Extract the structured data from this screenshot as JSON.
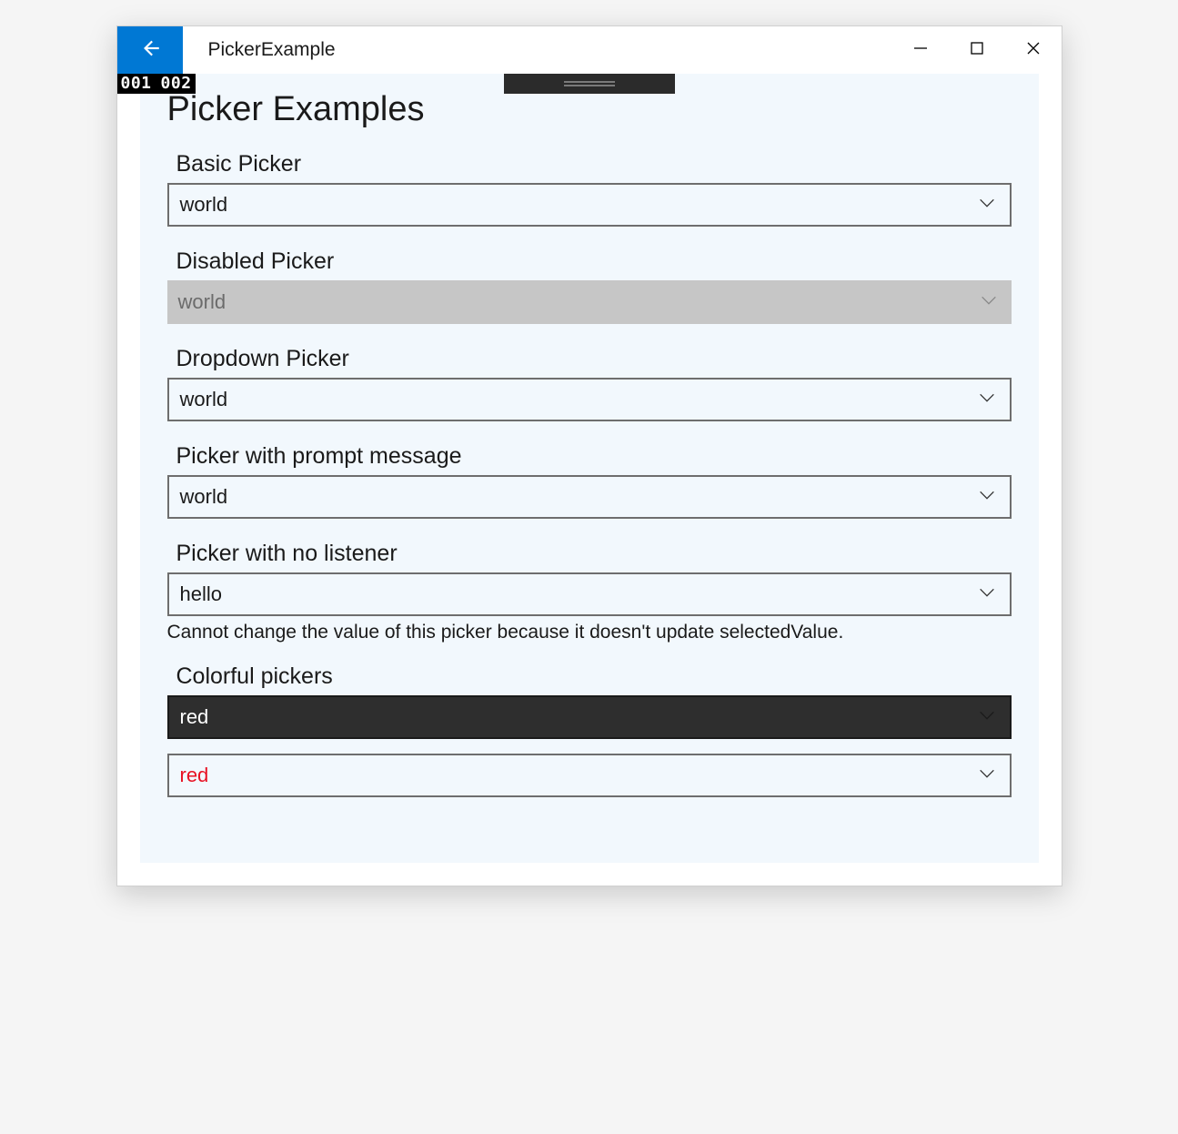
{
  "window": {
    "title": "PickerExample"
  },
  "fps": {
    "a": "001",
    "b": "002"
  },
  "page": {
    "title": "Picker Examples"
  },
  "sections": {
    "basic": {
      "label": "Basic Picker",
      "value": "world"
    },
    "disabled": {
      "label": "Disabled Picker",
      "value": "world"
    },
    "dropdown": {
      "label": "Dropdown Picker",
      "value": "world"
    },
    "prompt": {
      "label": "Picker with prompt message",
      "value": "world"
    },
    "nolistener": {
      "label": "Picker with no listener",
      "value": "hello",
      "note": "Cannot change the value of this picker because it doesn't update selectedValue."
    },
    "colorful": {
      "label": "Colorful pickers",
      "value1": "red",
      "value2": "red"
    }
  }
}
